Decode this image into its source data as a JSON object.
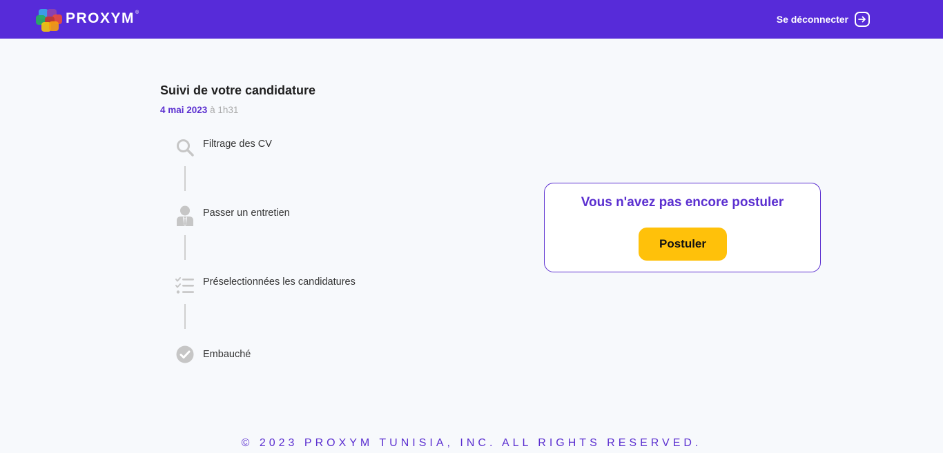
{
  "header": {
    "brand": "PROXYM",
    "brand_mark": "®",
    "logout_label": "Se déconnecter",
    "logout_icon": "arrow-right-circle-icon",
    "colors": {
      "bar": "#572bd9",
      "text": "#ffffff"
    }
  },
  "tracking": {
    "title": "Suivi de votre candidature",
    "date": "4 mai 2023",
    "time_sep": " à ",
    "time": "1h31",
    "steps": [
      {
        "label": "Filtrage des CV",
        "icon": "search-icon"
      },
      {
        "label": "Passer un entretien",
        "icon": "person-icon"
      },
      {
        "label": "Préselectionnées les candidatures",
        "icon": "checklist-icon"
      },
      {
        "label": "Embauché",
        "icon": "check-circle-icon"
      }
    ]
  },
  "apply": {
    "message": "Vous n'avez pas encore postuler",
    "button_label": "Postuler",
    "colors": {
      "accent": "#5b2fd0",
      "button": "#ffc10a"
    }
  },
  "footer": {
    "copyright": "© 2023 PROXYM TUNISIA, INC. ALL RIGHTS RESERVED."
  }
}
